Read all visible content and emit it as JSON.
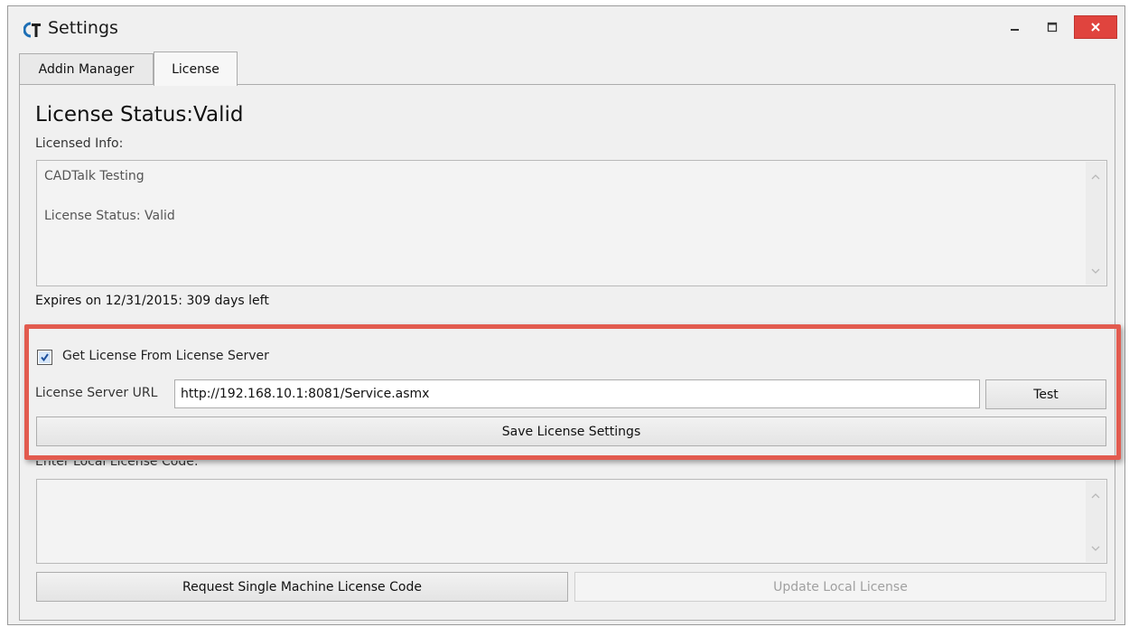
{
  "window": {
    "title": "Settings",
    "icons": {
      "app": "cadtalk-logo-icon",
      "minimize": "minimize-icon",
      "maximize": "maximize-icon",
      "close": "close-icon"
    },
    "close_color": "#e0443e"
  },
  "tabs": [
    {
      "label": "Addin Manager",
      "active": false
    },
    {
      "label": "License",
      "active": true
    }
  ],
  "license": {
    "status_heading": "License Status:Valid",
    "licensed_info_label": "Licensed Info:",
    "licensed_info_lines": [
      "CADTalk Testing",
      "",
      "License Status: Valid"
    ],
    "expires_text": "Expires on 12/31/2015: 309 days left"
  },
  "server": {
    "checkbox_label": "Get License From License Server",
    "checkbox_checked": true,
    "url_label": "License Server URL",
    "url_value": "http://192.168.10.1:8081/Service.asmx",
    "test_button": "Test",
    "save_button": "Save License Settings"
  },
  "local": {
    "code_label": "Enter Local License Code:",
    "code_value": "",
    "request_button": "Request Single Machine License Code",
    "update_button": "Update Local License",
    "update_disabled": true
  },
  "annotation": {
    "highlight_color": "#e25b4f"
  }
}
